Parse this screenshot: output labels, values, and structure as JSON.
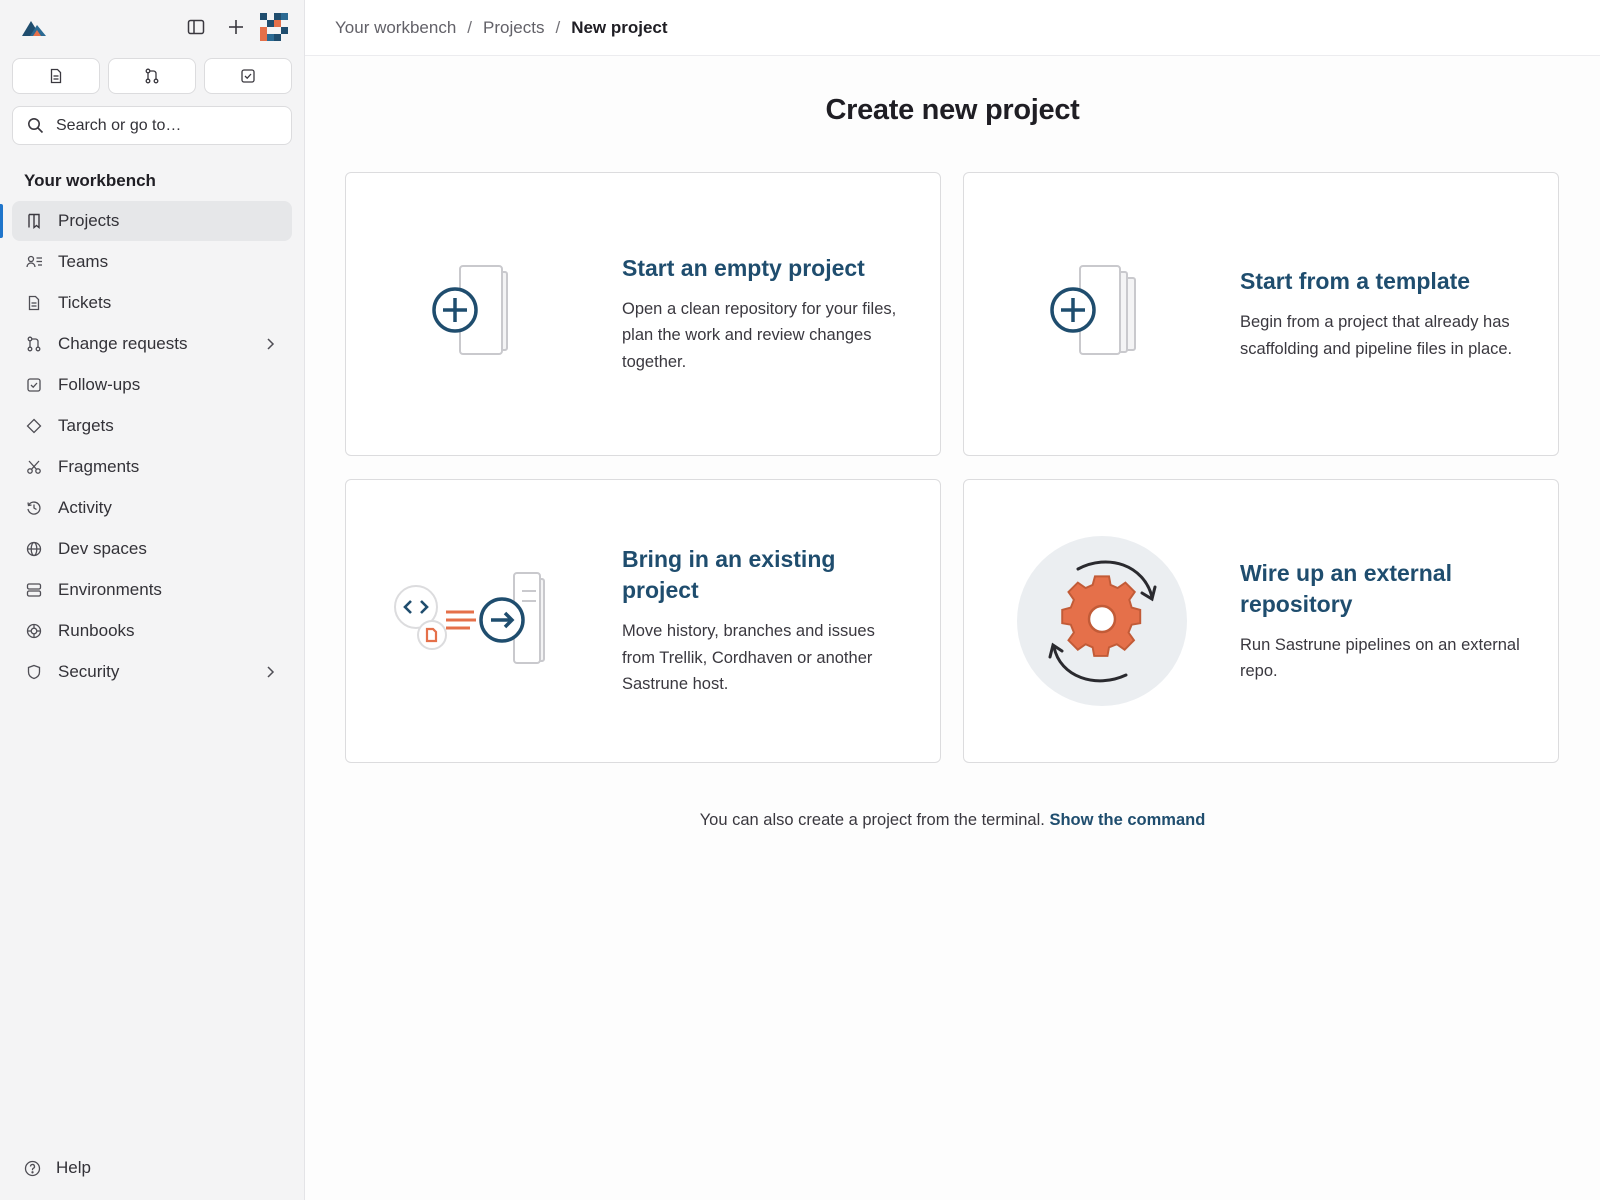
{
  "colors": {
    "accent": "#1f4d6e",
    "active_indicator": "#1f75cb",
    "illustration_orange": "#e5704a"
  },
  "sidebar": {
    "brand_icon": "mountain-logo-icon",
    "top_actions": [
      {
        "icon": "panel-toggle-icon"
      },
      {
        "icon": "plus-icon"
      },
      {
        "icon": "avatar-pixel-icon"
      }
    ],
    "quick_buttons": [
      {
        "icon": "ticket-icon"
      },
      {
        "icon": "merge-request-icon"
      },
      {
        "icon": "todo-check-icon"
      }
    ],
    "search": {
      "placeholder": "Search or go to…"
    },
    "section_title": "Your workbench",
    "items": [
      {
        "label": "Projects",
        "icon": "bookmark-icon",
        "active": true
      },
      {
        "label": "Teams",
        "icon": "users-icon"
      },
      {
        "label": "Tickets",
        "icon": "document-icon"
      },
      {
        "label": "Change requests",
        "icon": "merge-request-icon",
        "expandable": true
      },
      {
        "label": "Follow-ups",
        "icon": "checkbox-icon"
      },
      {
        "label": "Targets",
        "icon": "diamond-icon"
      },
      {
        "label": "Fragments",
        "icon": "scissors-icon"
      },
      {
        "label": "Activity",
        "icon": "history-icon"
      },
      {
        "label": "Dev spaces",
        "icon": "globe-icon"
      },
      {
        "label": "Environments",
        "icon": "server-icon"
      },
      {
        "label": "Runbooks",
        "icon": "lifebuoy-icon"
      },
      {
        "label": "Security",
        "icon": "shield-icon",
        "expandable": true
      }
    ],
    "help_label": "Help"
  },
  "breadcrumb": {
    "items": [
      "Your workbench",
      "Projects",
      "New project"
    ],
    "separator": "/"
  },
  "page": {
    "title": "Create new project",
    "cards": [
      {
        "title": "Start an empty project",
        "description": "Open a clean repository for your files, plan the work and review changes together.",
        "icon": "blank-project-illustration"
      },
      {
        "title": "Start from a template",
        "description": "Begin from a project that already has scaffolding and pipeline files in place.",
        "icon": "template-project-illustration"
      },
      {
        "title": "Bring in an existing project",
        "description": "Move history, branches and issues from Trellik, Cordhaven or another Sastrune host.",
        "icon": "import-project-illustration"
      },
      {
        "title": "Wire up an external repository",
        "description": "Run Sastrune pipelines on an external repo.",
        "icon": "external-repo-gear-illustration"
      }
    ],
    "footer_text": "You can also create a project from the terminal.",
    "footer_link": "Show the command"
  }
}
